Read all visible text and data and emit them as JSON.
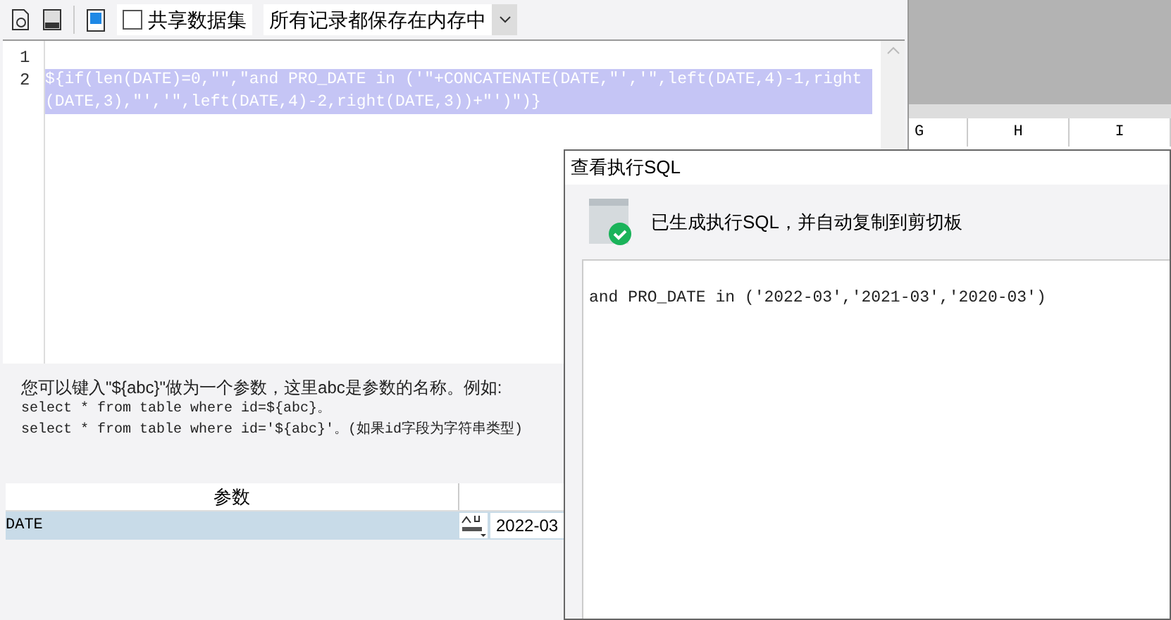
{
  "toolbar": {
    "share_dataset": {
      "label": "共享数据集",
      "checked": false
    },
    "storage": {
      "value": "所有记录都保存在内存中"
    }
  },
  "editor": {
    "lines": [
      {
        "number": "1"
      },
      {
        "number": "2",
        "text": "${if(len(DATE)=0,\"\",\"and PRO_DATE in ('\"+CONCATENATE(DATE,\"','\",left(DATE,4)-1,right(DATE,3),\"','\",left(DATE,4)-2,right(DATE,3))+\"')\")}",
        "selected": true
      }
    ]
  },
  "help": [
    "您可以键入\"${abc}\"做为一个参数，这里abc是参数的名称。例如:",
    "select * from table where id=${abc}。",
    "select * from table where id='${abc}'。(如果id字段为字符串类型)"
  ],
  "params": {
    "columns": [
      "参数"
    ],
    "rows": [
      {
        "name": "DATE",
        "value": "2022-03",
        "selected": true
      }
    ]
  },
  "sheet": {
    "columns": [
      "G",
      "H",
      "I"
    ]
  },
  "dialog": {
    "title": "查看执行SQL",
    "message": "已生成执行SQL，并自动复制到剪切板",
    "sql": "and PRO_DATE in ('2022-03','2021-03','2020-03')"
  }
}
